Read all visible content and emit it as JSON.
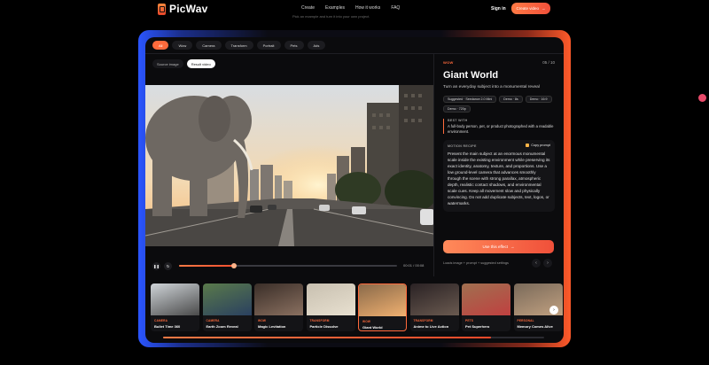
{
  "nav": {
    "brand": "PicWav",
    "links": [
      "Create",
      "Examples",
      "How it works",
      "FAQ"
    ],
    "signin": "Sign in",
    "create_button": "Create video",
    "create_icon": "arrow-right-icon"
  },
  "tagline": "Pick an example and turn it into your own project.",
  "filters": {
    "tabs": [
      "All",
      "Wow",
      "Camera",
      "Transform",
      "Portrait",
      "Pets",
      "Ads"
    ],
    "active": "All"
  },
  "source_toggle": {
    "options": [
      "Source image",
      "Result video"
    ],
    "active": "Result video"
  },
  "player": {
    "time": "00:01 / 00:08",
    "progress": 0.25,
    "play_icon": "pause-icon",
    "loop_icon": "replay-icon"
  },
  "details": {
    "category": "WOW",
    "counter": "05 / 10",
    "title": "Giant World",
    "subtitle": "Turn an everyday subject into a monumental reveal",
    "chips": [
      "Suggested · Seedance 2.0 Mini",
      "Demo · 8s",
      "Demo · 16:9",
      "Demo · 720p"
    ],
    "best_with_label": "BEST WITH",
    "best_with_text": "A full-body person, pet, or product photographed with a readable environment.",
    "recipe_label": "MOTION RECIPE",
    "copy_label": "Copy prompt",
    "recipe_text": "Present the main subject at an enormous monumental scale inside the existing environment while preserving its exact identity, anatomy, texture, and proportions. Use a low ground-level camera that advances smoothly through the scene with strong parallax, atmospheric depth, realistic contact shadows, and environmental scale cues. Keep all movement slow and physically convincing. Do not add duplicate subjects, text, logos, or watermarks.",
    "use_button": "Use this effect",
    "loads_text": "Loads image + prompt + suggested settings"
  },
  "thumbnails": [
    {
      "category": "CAMERA",
      "name": "Bullet Time 360",
      "active": false
    },
    {
      "category": "CAMERA",
      "name": "Earth Zoom Reveal",
      "active": false
    },
    {
      "category": "WOW",
      "name": "Magic Levitation",
      "active": false
    },
    {
      "category": "TRANSFORM",
      "name": "Particle Dissolve",
      "active": false
    },
    {
      "category": "WOW",
      "name": "Giant World",
      "active": true
    },
    {
      "category": "TRANSFORM",
      "name": "Anime to Live Action",
      "active": false
    },
    {
      "category": "PETS",
      "name": "Pet Superhero",
      "active": false
    },
    {
      "category": "PERSONAL",
      "name": "Memory Comes Alive",
      "active": false
    }
  ],
  "strip_progress": 0.86,
  "colors": {
    "accent": "#ff6a3c",
    "background": "#0b0b0d",
    "glow_left": "#2a55ff",
    "glow_right": "#ff5a2a"
  }
}
